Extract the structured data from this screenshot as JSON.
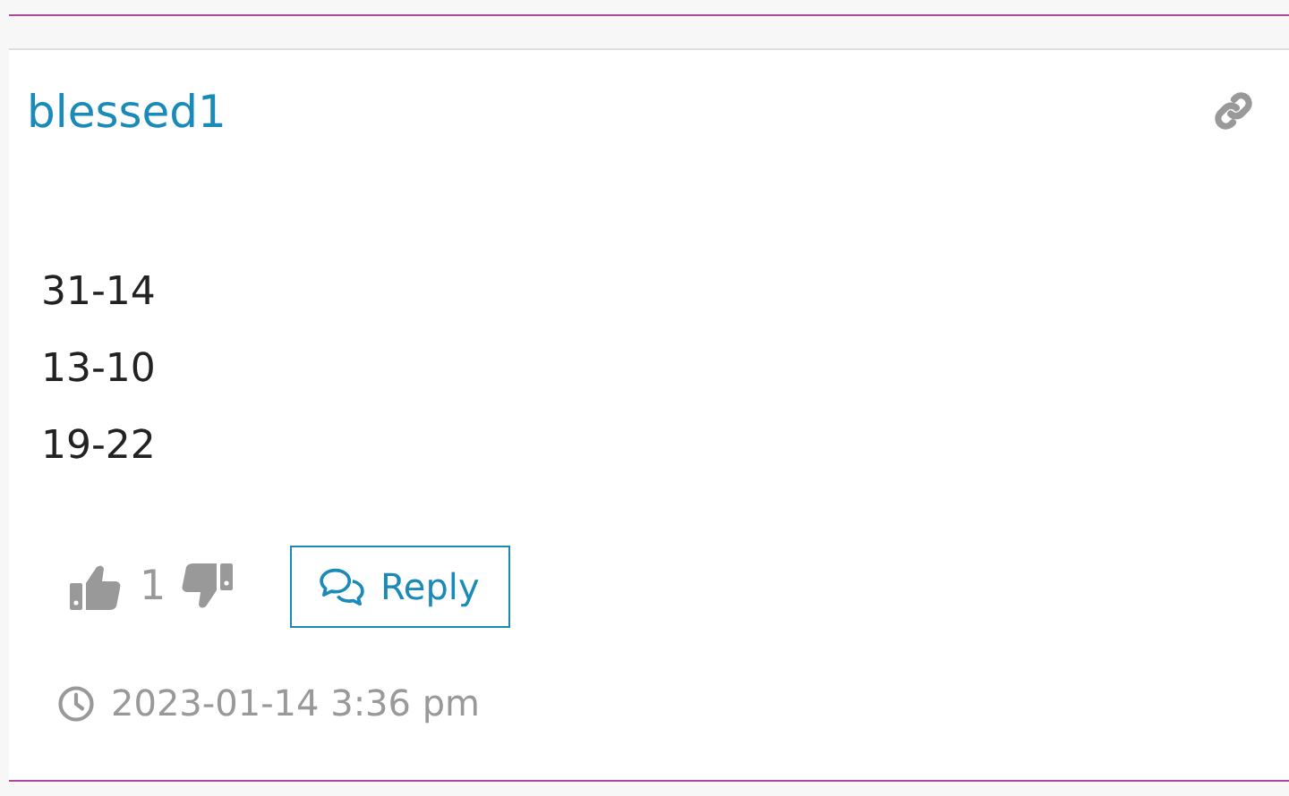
{
  "post": {
    "author": "blessed1",
    "body_lines": [
      "31-14",
      "13-10",
      "19-22"
    ],
    "likes": "1",
    "reply_label": "Reply",
    "timestamp": "2023-01-14 3:36 pm"
  }
}
